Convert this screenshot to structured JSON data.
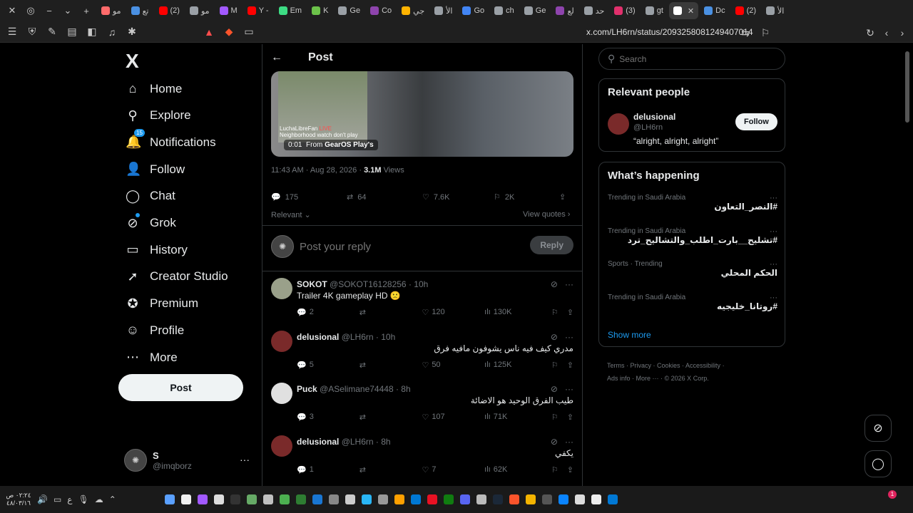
{
  "browser": {
    "tabs": [
      {
        "label": "مو",
        "color": "#ff6b6b"
      },
      {
        "label": "تع",
        "color": "#4a90e2"
      },
      {
        "label": "(2)",
        "color": "#ff0000"
      },
      {
        "label": "مو",
        "color": "#9aa0a6"
      },
      {
        "label": "M",
        "color": "#a259ff"
      },
      {
        "label": "Y -",
        "color": "#ff0000"
      },
      {
        "label": "Em",
        "color": "#3ddc84"
      },
      {
        "label": "K",
        "color": "#6cc24a"
      },
      {
        "label": "Ge",
        "color": "#9aa0a6"
      },
      {
        "label": "Co",
        "color": "#8e44ad"
      },
      {
        "label": "جي",
        "color": "#ffb300"
      },
      {
        "label": "الأ",
        "color": "#9aa0a6"
      },
      {
        "label": "Go",
        "color": "#4285f4"
      },
      {
        "label": "ch",
        "color": "#9aa0a6"
      },
      {
        "label": "Ge",
        "color": "#9aa0a6"
      },
      {
        "label": "لع",
        "color": "#8e44ad"
      },
      {
        "label": "حد",
        "color": "#9aa0a6"
      },
      {
        "label": "(3)",
        "color": "#e1306c"
      },
      {
        "label": "gt",
        "color": "#9aa0a6"
      },
      {
        "label": "",
        "color": "#ffffff",
        "active": true
      },
      {
        "label": "Dc",
        "color": "#4a90e2"
      },
      {
        "label": "(2)",
        "color": "#ff0000"
      },
      {
        "label": "الأ",
        "color": "#9aa0a6"
      }
    ],
    "url": "x.com/LH6rn/status/2093258081249407014"
  },
  "nav": {
    "logo": "X",
    "items": [
      {
        "label": "Home",
        "icon": "⌂",
        "name": "home"
      },
      {
        "label": "Explore",
        "icon": "⚲",
        "name": "explore"
      },
      {
        "label": "Notifications",
        "icon": "🔔",
        "name": "notifications",
        "badge": "15"
      },
      {
        "label": "Follow",
        "icon": "👤",
        "name": "follow"
      },
      {
        "label": "Chat",
        "icon": "◯",
        "name": "chat"
      },
      {
        "label": "Grok",
        "icon": "⊘",
        "name": "grok",
        "dot": true
      },
      {
        "label": "History",
        "icon": "▭",
        "name": "history"
      },
      {
        "label": "Creator Studio",
        "icon": "➚",
        "name": "creator-studio"
      },
      {
        "label": "Premium",
        "icon": "✪",
        "name": "premium"
      },
      {
        "label": "Profile",
        "icon": "☺",
        "name": "profile"
      },
      {
        "label": "More",
        "icon": "⋯",
        "name": "more"
      }
    ],
    "post_button": "Post",
    "account": {
      "name": "S",
      "handle": "@imqborz"
    }
  },
  "main": {
    "title": "Post",
    "media": {
      "time": "0:01",
      "from_label": "From",
      "source": "GearOS Play's",
      "overlay_line1": "LuchaLibreFan",
      "overlay_live": "LIVE",
      "overlay_line2": "Neighborhood watch don't play"
    },
    "meta": {
      "time": "11:43 AM · Aug 28, 2026 · ",
      "views": "3.1M",
      "views_label": " Views"
    },
    "stats": {
      "replies": "175",
      "reposts": "64",
      "likes": "7.6K",
      "bookmarks": "2K"
    },
    "sort_label": "Relevant",
    "view_quotes": "View quotes",
    "reply_placeholder": "Post your reply",
    "reply_button": "Reply",
    "replies": [
      {
        "name": "SOKOT",
        "handle": "@SOKOT16128256",
        "time": "· 10h",
        "text": "Trailer 4K gameplay HD 🙁",
        "rtl": false,
        "replies": "2",
        "likes": "120",
        "views": "130K",
        "avatar": "#9aa08a"
      },
      {
        "name": "delusional",
        "handle": "@LH6rn",
        "time": "· 10h",
        "text": "مدري كيف فيه ناس يشوفون مافيه فرق",
        "rtl": true,
        "replies": "5",
        "likes": "50",
        "views": "125K",
        "avatar": "#7a2a2a"
      },
      {
        "name": "Puck",
        "handle": "@ASelimane74448",
        "time": "· 8h",
        "text": "طيب الفرق الوحيد هو الاضائة",
        "rtl": true,
        "replies": "3",
        "likes": "107",
        "views": "71K",
        "avatar": "#e0e0e0"
      },
      {
        "name": "delusional",
        "handle": "@LH6rn",
        "time": "· 8h",
        "text": "يكفي",
        "rtl": true,
        "replies": "1",
        "likes": "7",
        "views": "62K",
        "avatar": "#7a2a2a"
      }
    ]
  },
  "right": {
    "search_placeholder": "Search",
    "relevant": {
      "title": "Relevant people",
      "name": "delusional",
      "handle": "@LH6rn",
      "bio": "“alright, alright, alright”",
      "follow": "Follow"
    },
    "happening": {
      "title": "What’s happening",
      "trends": [
        {
          "category": "Trending in Saudi Arabia",
          "name": "#النصر_التعاون"
        },
        {
          "category": "Trending in Saudi Arabia",
          "name": "#تشليح__بارت_اطلب_والتشاليح_ترد"
        },
        {
          "category": "Sports · Trending",
          "name": "الحكم المحلي"
        },
        {
          "category": "Trending in Saudi Arabia",
          "name": "#روتانا_خليجيه"
        }
      ],
      "show_more": "Show more"
    },
    "footer": {
      "terms": "Terms",
      "privacy": "Privacy",
      "cookies": "Cookies",
      "accessibility": "Accessibility",
      "ads": "Ads info",
      "more": "More ···",
      "copyright": "© 2026 X Corp."
    }
  },
  "taskbar": {
    "time": "٠٢:٢٤ ص",
    "date": "٤٨/٠٣/١٦",
    "lang": "ع",
    "notif_count": "1"
  }
}
